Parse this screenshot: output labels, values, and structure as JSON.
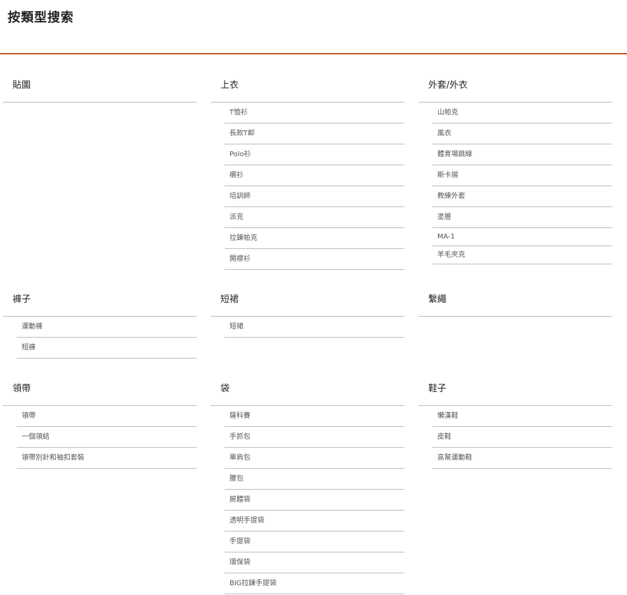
{
  "page": {
    "title": "按類型搜索"
  },
  "categories": [
    {
      "name": "貼圖",
      "items": []
    },
    {
      "name": "上衣",
      "items": [
        "T恤衫",
        "長款T卹",
        "Polo衫",
        "襯衫",
        "培訓師",
        "派克",
        "拉鍊帕克",
        "開襟衫"
      ]
    },
    {
      "name": "外套/外衣",
      "items": [
        "山帕克",
        "風衣",
        "體育場跳線",
        "斯卡揚",
        "教練外套",
        "塗層",
        "MA-1",
        "羊毛夾克"
      ]
    },
    {
      "name": "褲子",
      "items": [
        "運動褲",
        "短褲"
      ]
    },
    {
      "name": "短裙",
      "items": [
        "短裙"
      ]
    },
    {
      "name": "繫繩",
      "items": []
    },
    {
      "name": "領帶",
      "items": [
        "領帶",
        "一個領結",
        "領帶別針和袖扣套裝"
      ]
    },
    {
      "name": "袋",
      "items": [
        "薩科賽",
        "手抓包",
        "單肩包",
        "腰包",
        "屍體袋",
        "透明手提袋",
        "手提袋",
        "環保袋",
        "BIG拉鍊手提袋"
      ]
    },
    {
      "name": "鞋子",
      "items": [
        "懶漢鞋",
        "皮鞋",
        "高幫運動鞋"
      ]
    }
  ]
}
